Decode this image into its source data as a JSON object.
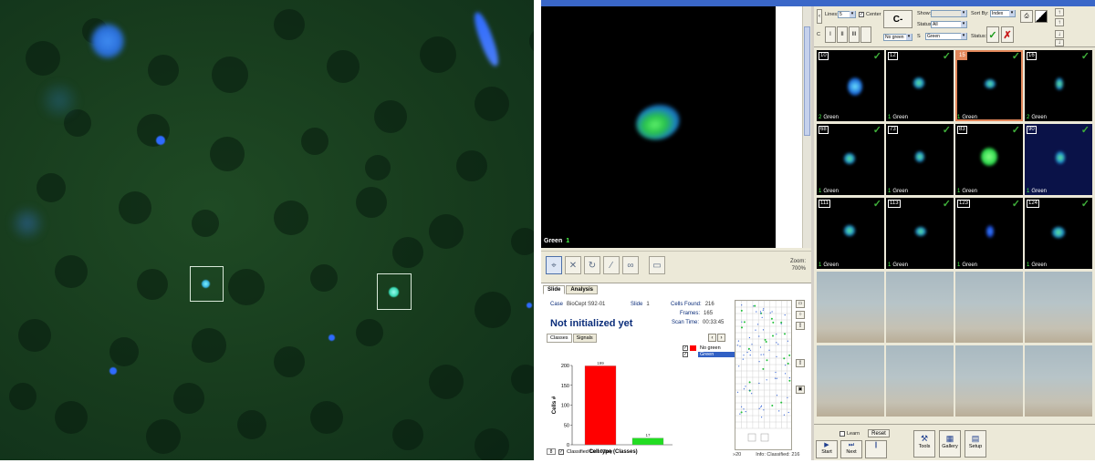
{
  "viewer": {
    "channel": "Green",
    "count": "1",
    "zoom_label": "Zoom:",
    "zoom_value": "700%"
  },
  "toolbar": {
    "lines_label": "Lines:",
    "lines_value": "5",
    "center_label": "Center",
    "c_label": "C",
    "c_button": "C-",
    "class_value": "No green",
    "buttons": [
      "I",
      "II",
      "III"
    ],
    "show_label": "Show:",
    "status_label": "Status:",
    "status_value": "All",
    "s_label": "S",
    "s_value": "Green",
    "sort_label": "Sort By:",
    "sort_value": "Index",
    "status2_label": "Status:"
  },
  "slide": {
    "tabs": [
      "Slide",
      "Analysis"
    ],
    "case_label": "Case",
    "case_value": "BioCept S92-01",
    "slide_label": "Slide",
    "slide_value": "1",
    "cells_found_label": "Cells Found:",
    "cells_found_value": "216",
    "frames_label": "Frames:",
    "frames_value": "165",
    "scan_time_label": "Scan Time:",
    "scan_time_value": "00:33:45",
    "status_text": "Not initialized yet",
    "subtabs": [
      "Classes",
      "Signals"
    ],
    "legend": [
      {
        "label": "No green",
        "color": "#ff0000",
        "checked": "✓"
      },
      {
        "label": "Green",
        "color": "#ffffff",
        "checked": "✓"
      }
    ],
    "classified_only": "Classified Cells Only",
    "classified_box": "8",
    "map_footer_count": "20",
    "map_footer_info": "Info: Classified: 216"
  },
  "chart_data": {
    "type": "bar",
    "categories": [
      "No green",
      "Green"
    ],
    "values": [
      199,
      17
    ],
    "colors": [
      "#ff0000",
      "#22dd22"
    ],
    "xlabel": "Cell type (Classes)",
    "ylabel": "Cells #",
    "ylim": [
      0,
      200
    ],
    "yticks": [
      0,
      50,
      100,
      150,
      200
    ]
  },
  "gallery": [
    {
      "num": "10",
      "count": "2",
      "label": "Green",
      "checked": "✓"
    },
    {
      "num": "12",
      "count": "1",
      "label": "Green",
      "checked": "✓"
    },
    {
      "num": "15",
      "count": "1",
      "label": "Green",
      "checked": "✓"
    },
    {
      "num": "16",
      "count": "2",
      "label": "Green",
      "checked": "✓"
    },
    {
      "num": "68",
      "count": "1",
      "label": "Green",
      "checked": "✓"
    },
    {
      "num": "73",
      "count": "1",
      "label": "Green",
      "checked": "✓"
    },
    {
      "num": "83",
      "count": "1",
      "label": "Green",
      "checked": "✓"
    },
    {
      "num": "90",
      "count": "1",
      "label": "Green",
      "checked": "✓"
    },
    {
      "num": "111",
      "count": "1",
      "label": "Green",
      "checked": "✓"
    },
    {
      "num": "113",
      "count": "1",
      "label": "Green",
      "checked": "✓"
    },
    {
      "num": "123",
      "count": "1",
      "label": "Green",
      "checked": "✓"
    },
    {
      "num": "124",
      "count": "1",
      "label": "Green",
      "checked": "✓"
    }
  ],
  "learn": {
    "learn_label": "Learn",
    "reset_label": "Reset"
  },
  "bottom_buttons": [
    {
      "icon": "play-icon",
      "label": "Start"
    },
    {
      "icon": "next-icon",
      "label": "Next"
    },
    {
      "icon": "pause-icon",
      "label": ""
    },
    {
      "icon": "tools-icon",
      "label": "Tools"
    },
    {
      "icon": "gallery-icon",
      "label": "Gallery"
    },
    {
      "icon": "setup-icon",
      "label": "Setup"
    }
  ],
  "colors": {
    "accent": "#3160c4",
    "selected_tile": "#e2875a",
    "check_green": "#3fae3a",
    "title_blue": "#0b2d7a"
  }
}
